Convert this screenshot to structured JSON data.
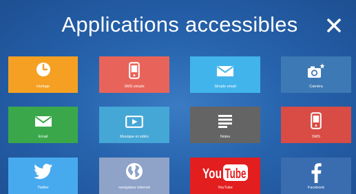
{
  "header": {
    "title": "Applications accessibles",
    "close_icon": "close-icon"
  },
  "tiles": [
    {
      "label": "Horloge",
      "icon": "clock-icon",
      "color": "#f5a023"
    },
    {
      "label": "SMS simple",
      "icon": "phone-icon",
      "color": "#e8645a"
    },
    {
      "label": "Simple email",
      "icon": "envelope-icon",
      "color": "#42b4ec"
    },
    {
      "label": "Caméra",
      "icon": "camera-icon",
      "color": "#3d79b5"
    },
    {
      "label": "Email",
      "icon": "envelope-icon",
      "color": "#3aa84a"
    },
    {
      "label": "Musique et vidéo",
      "icon": "play-icon",
      "color": "#45a7d6"
    },
    {
      "label": "Notes",
      "icon": "notes-icon",
      "color": "#646464"
    },
    {
      "label": "SMS",
      "icon": "phone-icon",
      "color": "#d84c45"
    },
    {
      "label": "Twitter",
      "icon": "twitter-bird-icon",
      "color": "#48aaee"
    },
    {
      "label": "navigateur internet",
      "icon": "globe-icon",
      "color": "#8fa3c8"
    },
    {
      "label": "YouTube",
      "icon": "youtube-logo",
      "color": "#e31e1e",
      "logo_text": "You Tube"
    },
    {
      "label": "Facebook",
      "icon": "facebook-icon",
      "color": "#3a6db0"
    }
  ]
}
